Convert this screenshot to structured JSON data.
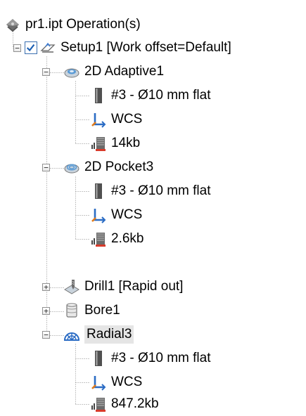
{
  "colors": {
    "tree_line": "#8c8c8c",
    "selected_bg": "#e5e5e5",
    "check": "#1a5fb4",
    "tool": "#505050",
    "wcs_blue": "#2b6cc4",
    "wcs_orange": "#e07a1a",
    "file_red": "#d83a2a"
  },
  "tree": {
    "root": {
      "label": "pr1.ipt Operation(s)",
      "icon": "cam-operations-icon"
    },
    "setup": {
      "label": "Setup1 [Work offset=Default]",
      "icon": "setup-icon",
      "checked": true,
      "expanded": true
    },
    "adaptive": {
      "label": "2D Adaptive1",
      "icon": "adaptive-op-icon",
      "expanded": true,
      "tool": "#3 - Ø10 mm flat",
      "wcs": "WCS",
      "size": "14kb"
    },
    "pocket": {
      "label": "2D Pocket3",
      "icon": "pocket-op-icon",
      "expanded": true,
      "tool": "#3 - Ø10 mm flat",
      "wcs": "WCS",
      "size": "2.6kb"
    },
    "drill": {
      "label": "Drill1 [Rapid out]",
      "icon": "drill-op-icon",
      "expanded": false
    },
    "bore": {
      "label": "Bore1",
      "icon": "bore-op-icon",
      "expanded": false
    },
    "radial": {
      "label": "Radial3",
      "icon": "radial-op-icon",
      "expanded": true,
      "selected": true,
      "tool": "#3 - Ø10 mm flat",
      "wcs": "WCS",
      "size": "847.2kb"
    }
  }
}
